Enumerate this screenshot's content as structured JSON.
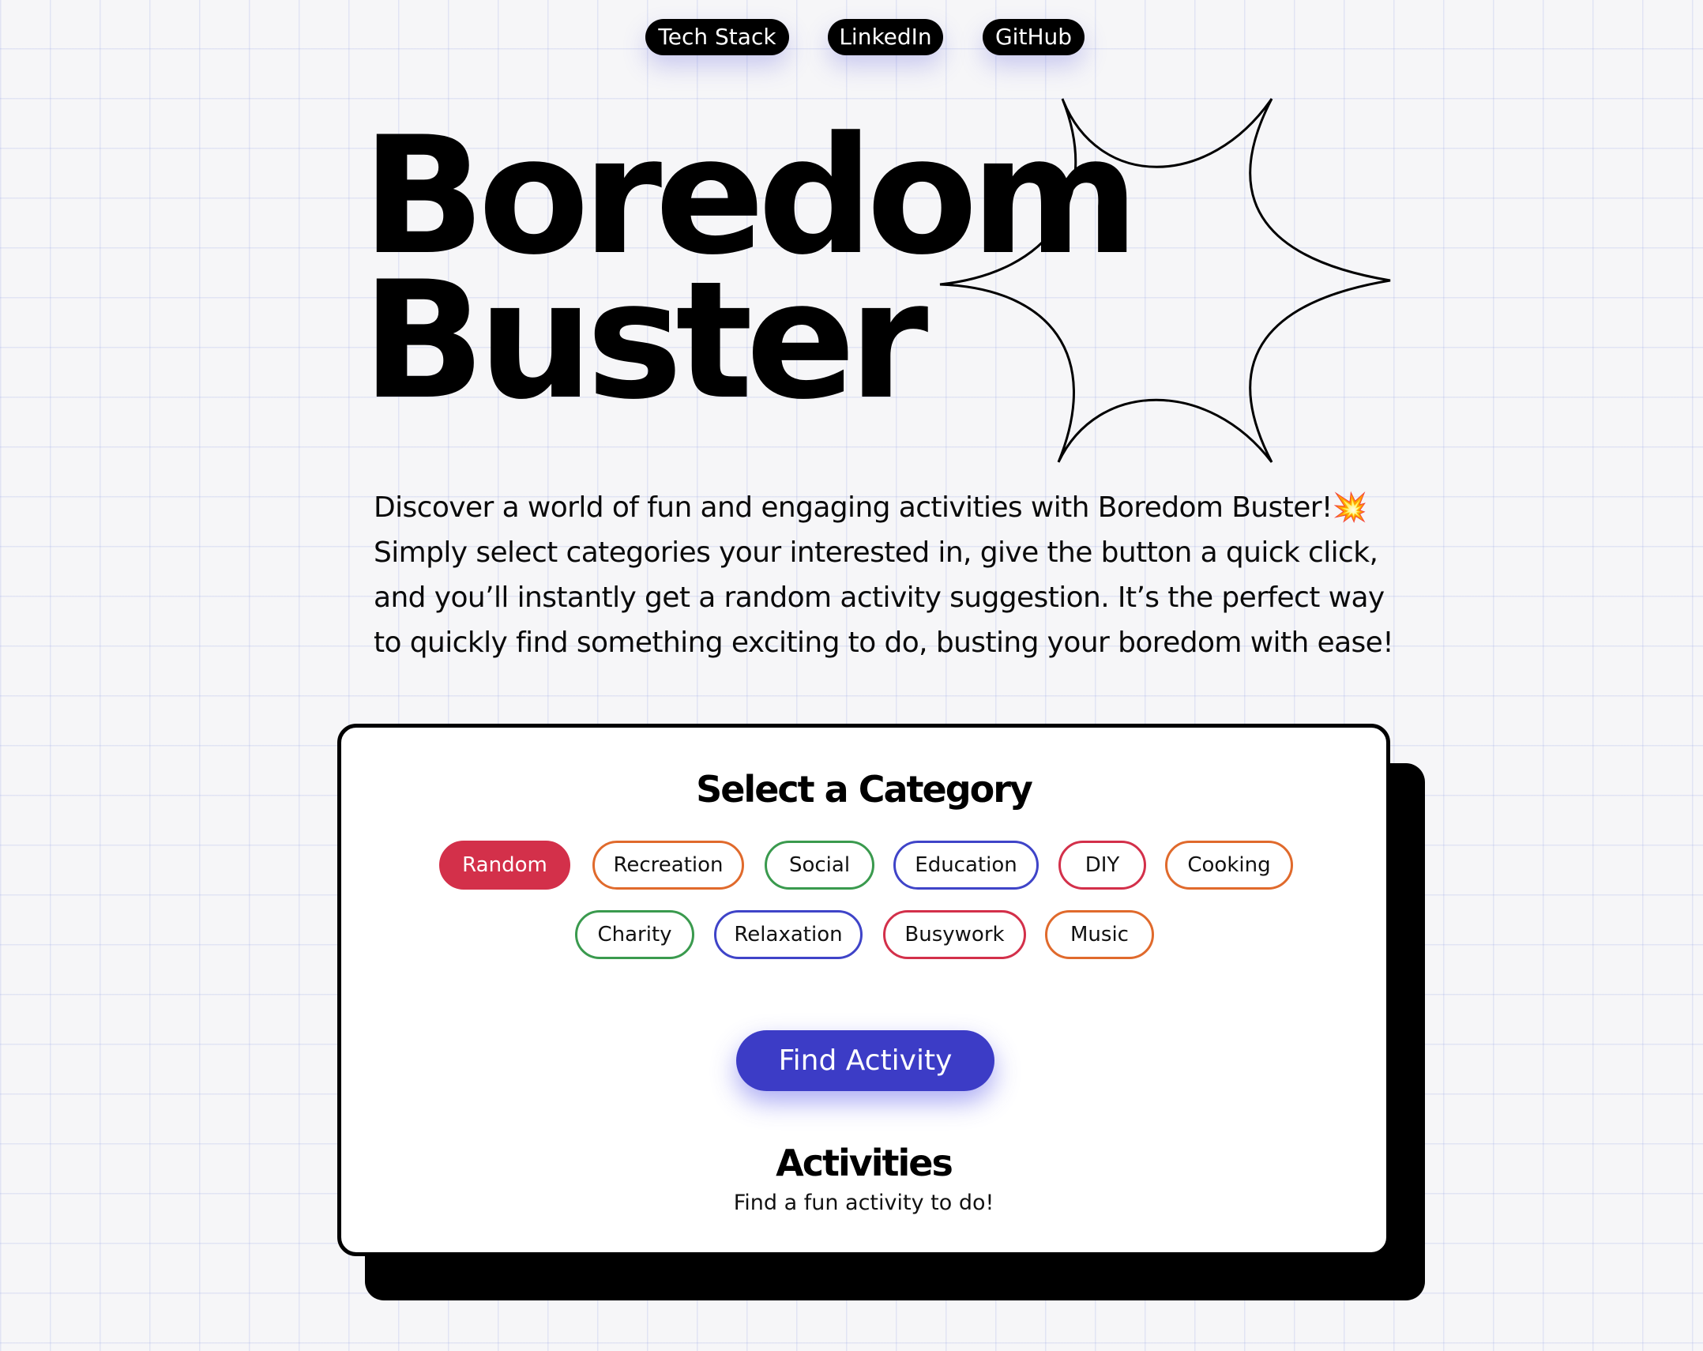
{
  "nav": {
    "links": [
      {
        "label": "Tech Stack"
      },
      {
        "label": "LinkedIn"
      },
      {
        "label": "GitHub"
      }
    ]
  },
  "hero": {
    "title_line1": "Boredom",
    "title_line2": "Buster",
    "description": "Discover a world of fun and engaging activities with Boredom Buster!💥 Simply select categories your interested in, give the button a quick click, and you’ll instantly get a random activity suggestion. It’s the perfect way to quickly find something exciting to do, busting your boredom with ease!"
  },
  "category_panel": {
    "heading": "Select a Category",
    "categories": [
      {
        "label": "Random",
        "color": "#d3304a",
        "selected": true
      },
      {
        "label": "Recreation",
        "color": "#e06a2c",
        "selected": false
      },
      {
        "label": "Social",
        "color": "#3a9a4e",
        "selected": false
      },
      {
        "label": "Education",
        "color": "#3f44c8",
        "selected": false
      },
      {
        "label": "DIY",
        "color": "#d3304a",
        "selected": false
      },
      {
        "label": "Cooking",
        "color": "#e06a2c",
        "selected": false
      },
      {
        "label": "Charity",
        "color": "#3a9a4e",
        "selected": false
      },
      {
        "label": "Relaxation",
        "color": "#3f44c8",
        "selected": false
      },
      {
        "label": "Busywork",
        "color": "#d3304a",
        "selected": false
      },
      {
        "label": "Music",
        "color": "#e06a2c",
        "selected": false
      }
    ],
    "find_button_label": "Find Activity",
    "activities_heading": "Activities",
    "activities_text": "Find a fun activity to do!"
  },
  "colors": {
    "accent_primary": "#3c3cc6",
    "selected_chip": "#d3304a",
    "background": "#f6f6f8",
    "card_border": "#000000"
  }
}
